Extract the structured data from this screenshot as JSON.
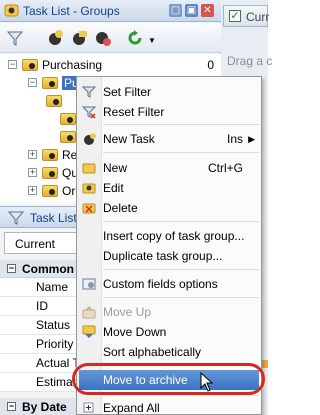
{
  "window": {
    "title": "Task List - Groups"
  },
  "tree": [
    {
      "label": "Purchasing",
      "count": "0"
    },
    {
      "label": "Purchasing"
    },
    {
      "label": "Rec"
    },
    {
      "label": "Qu"
    },
    {
      "label": "Ord"
    }
  ],
  "panel2": {
    "title": "Task List -",
    "combo_value": "Current"
  },
  "properties": {
    "category_common": "Common",
    "rows": [
      "Name",
      "ID",
      "Status",
      "Priority",
      "Actual Ti",
      "Estimated"
    ],
    "category_bydate": "By Date"
  },
  "right": {
    "header_label": "Curr",
    "drag_hint": "Drag a c"
  },
  "menu": {
    "set_filter": "Set Filter",
    "reset_filter": "Reset Filter",
    "new_task": "New Task",
    "new_task_shortcut": "Ins",
    "new": "New",
    "new_shortcut": "Ctrl+G",
    "edit": "Edit",
    "delete": "Delete",
    "insert_copy": "Insert copy of task group...",
    "duplicate": "Duplicate task group...",
    "custom_fields": "Custom fields options",
    "move_up": "Move Up",
    "move_down": "Move Down",
    "sort_alpha": "Sort alphabetically",
    "move_to_archive": "Move to archive",
    "expand_all": "Expand All"
  },
  "colors": {
    "accent": "#3b73c2",
    "ring": "#d22a1f",
    "title_text": "#15428b"
  }
}
